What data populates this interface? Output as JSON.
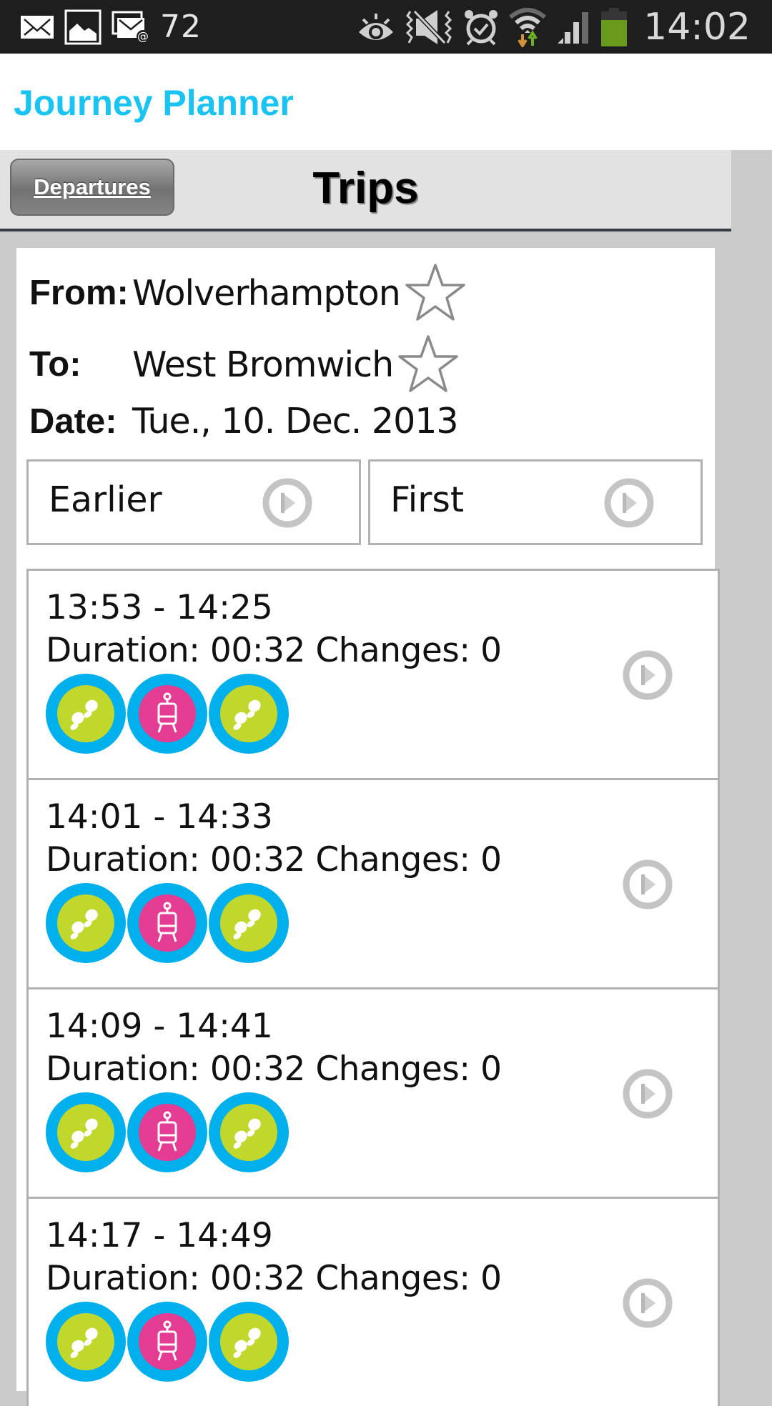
{
  "status_bar": {
    "left_icons": [
      "email-icon",
      "gallery-icon",
      "email-multi-icon"
    ],
    "notification_count": "72",
    "right_icons": [
      "smart-stay-eye-icon",
      "mute-vibrate-icon",
      "alarm-icon",
      "wifi-icon",
      "signal-icon",
      "battery-icon"
    ],
    "time": "14:02",
    "colors": {
      "background": "#1e1e1e",
      "battery": "#6a9a1c"
    }
  },
  "app": {
    "title": "Journey Planner",
    "title_color": "#19c3f2"
  },
  "toolbar": {
    "back_button_label": "Departures",
    "page_title": "Trips"
  },
  "query": {
    "from_label": "From:",
    "from_value": "Wolverhampton",
    "to_label": "To:",
    "to_value": "West Bromwich",
    "date_label": "Date:",
    "date_value": "Tue., 10. Dec. 2013",
    "favorite_icon": "star-outline-icon"
  },
  "nav_buttons": [
    {
      "label": "Earlier",
      "icon": "play-circle-icon"
    },
    {
      "label": "First",
      "icon": "play-circle-icon"
    }
  ],
  "trips": [
    {
      "times": "13:53 - 14:25",
      "duration_label": "Duration:",
      "duration": "00:32",
      "changes_label": "Changes:",
      "changes": "0",
      "modes": [
        "walk",
        "tram",
        "walk"
      ]
    },
    {
      "times": "14:01 - 14:33",
      "duration_label": "Duration:",
      "duration": "00:32",
      "changes_label": "Changes:",
      "changes": "0",
      "modes": [
        "walk",
        "tram",
        "walk"
      ]
    },
    {
      "times": "14:09 - 14:41",
      "duration_label": "Duration:",
      "duration": "00:32",
      "changes_label": "Changes:",
      "changes": "0",
      "modes": [
        "walk",
        "tram",
        "walk"
      ]
    },
    {
      "times": "14:17 - 14:49",
      "duration_label": "Duration:",
      "duration": "00:32",
      "changes_label": "Changes:",
      "changes": "0",
      "modes": [
        "walk",
        "tram",
        "walk"
      ]
    }
  ],
  "mode_colors": {
    "ring": "#00b0ec",
    "walk": "#c2d72b",
    "tram": "#e43b93"
  }
}
